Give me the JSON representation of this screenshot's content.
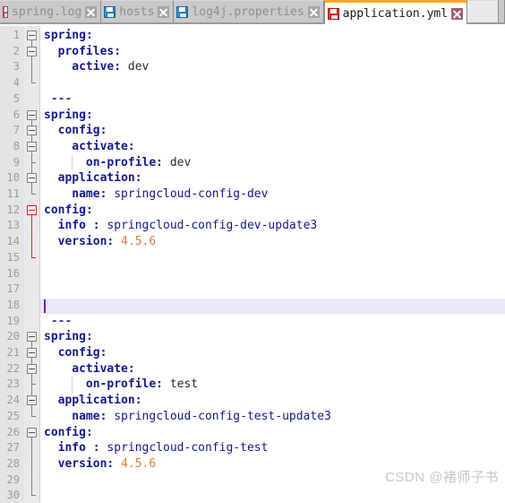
{
  "window": {
    "app_kind": "text-editor",
    "accent_active_tab": "#f5a623",
    "current_line_highlight": "#e8e8f8"
  },
  "tabbar": {
    "tabs": [
      {
        "label": "spring.log",
        "icon": "floppy-disk-icon",
        "icon_color": "#d06a87",
        "active": false,
        "close_label": "close-tab"
      },
      {
        "label": "hosts",
        "icon": "floppy-disk-icon",
        "icon_color": "#3d8fd8",
        "active": false,
        "close_label": "close-tab"
      },
      {
        "label": "log4j.properties",
        "icon": "floppy-disk-icon",
        "icon_color": "#3d8fd8",
        "active": false,
        "close_label": "close-tab"
      },
      {
        "label": "application.yml",
        "icon": "floppy-disk-icon",
        "icon_color": "#e03b2f",
        "active": true,
        "close_label": "close-tab"
      }
    ]
  },
  "editor": {
    "language": "yaml",
    "current_line": 18,
    "first_visible_line": 1,
    "last_visible_line": 30,
    "line_numbers": [
      "1",
      "2",
      "3",
      "4",
      "5",
      "6",
      "7",
      "8",
      "9",
      "10",
      "11",
      "12",
      "13",
      "14",
      "15",
      "16",
      "17",
      "18",
      "19",
      "20",
      "21",
      "22",
      "23",
      "24",
      "25",
      "26",
      "27",
      "28",
      "29",
      "30"
    ],
    "lines": [
      {
        "n": 1,
        "indent": 0,
        "key": "spring:",
        "value": "",
        "value_kind": "none"
      },
      {
        "n": 2,
        "indent": 2,
        "key": "profiles:",
        "value": "",
        "value_kind": "none"
      },
      {
        "n": 3,
        "indent": 4,
        "key": "active:",
        "value": "dev",
        "value_kind": "plain"
      },
      {
        "n": 4,
        "indent": 0,
        "key": "",
        "value": "",
        "value_kind": "none"
      },
      {
        "n": 5,
        "indent": 1,
        "key": "",
        "value": "---",
        "value_kind": "separator"
      },
      {
        "n": 6,
        "indent": 0,
        "key": "spring:",
        "value": "",
        "value_kind": "none"
      },
      {
        "n": 7,
        "indent": 2,
        "key": "config:",
        "value": "",
        "value_kind": "none"
      },
      {
        "n": 8,
        "indent": 4,
        "key": "activate:",
        "value": "",
        "value_kind": "none"
      },
      {
        "n": 9,
        "indent": 6,
        "key": "on-profile:",
        "value": "dev",
        "value_kind": "plain"
      },
      {
        "n": 10,
        "indent": 2,
        "key": "application:",
        "value": "",
        "value_kind": "none"
      },
      {
        "n": 11,
        "indent": 4,
        "key": "name:",
        "value": "springcloud-config-dev",
        "value_kind": "navy"
      },
      {
        "n": 12,
        "indent": 0,
        "key": "config:",
        "value": "",
        "value_kind": "none"
      },
      {
        "n": 13,
        "indent": 2,
        "key": "info :",
        "value": "springcloud-config-dev-update3",
        "value_kind": "navy"
      },
      {
        "n": 14,
        "indent": 2,
        "key": "version:",
        "value": "4.5.6",
        "value_kind": "number"
      },
      {
        "n": 15,
        "indent": 0,
        "key": "",
        "value": "",
        "value_kind": "none"
      },
      {
        "n": 16,
        "indent": 0,
        "key": "",
        "value": "",
        "value_kind": "none"
      },
      {
        "n": 17,
        "indent": 0,
        "key": "",
        "value": "",
        "value_kind": "none"
      },
      {
        "n": 18,
        "indent": 0,
        "key": "",
        "value": "",
        "value_kind": "none"
      },
      {
        "n": 19,
        "indent": 1,
        "key": "",
        "value": "---",
        "value_kind": "separator"
      },
      {
        "n": 20,
        "indent": 0,
        "key": "spring:",
        "value": "",
        "value_kind": "none"
      },
      {
        "n": 21,
        "indent": 2,
        "key": "config:",
        "value": "",
        "value_kind": "none"
      },
      {
        "n": 22,
        "indent": 4,
        "key": "activate:",
        "value": "",
        "value_kind": "none"
      },
      {
        "n": 23,
        "indent": 6,
        "key": "on-profile:",
        "value": "test",
        "value_kind": "plain"
      },
      {
        "n": 24,
        "indent": 2,
        "key": "application:",
        "value": "",
        "value_kind": "none"
      },
      {
        "n": 25,
        "indent": 4,
        "key": "name:",
        "value": "springcloud-config-test-update3",
        "value_kind": "navy"
      },
      {
        "n": 26,
        "indent": 0,
        "key": "config:",
        "value": "",
        "value_kind": "none"
      },
      {
        "n": 27,
        "indent": 2,
        "key": "info :",
        "value": "springcloud-config-test",
        "value_kind": "navy"
      },
      {
        "n": 28,
        "indent": 2,
        "key": "version:",
        "value": "4.5.6",
        "value_kind": "number"
      },
      {
        "n": 29,
        "indent": 0,
        "key": "",
        "value": "",
        "value_kind": "none"
      },
      {
        "n": 30,
        "indent": 0,
        "key": "",
        "value": "",
        "value_kind": "none"
      }
    ],
    "fold_markers": [
      {
        "line": 1,
        "state": "expanded",
        "color": "#808080",
        "span_to": 4
      },
      {
        "line": 2,
        "state": "expanded",
        "color": "#808080",
        "span_to": 4
      },
      {
        "line": 6,
        "state": "expanded",
        "color": "#808080",
        "span_to": 11
      },
      {
        "line": 7,
        "state": "expanded",
        "color": "#808080",
        "span_to": 11
      },
      {
        "line": 8,
        "state": "expanded",
        "color": "#808080",
        "span_to": 9
      },
      {
        "line": 10,
        "state": "expanded",
        "color": "#808080",
        "span_to": 11
      },
      {
        "line": 12,
        "state": "expanded",
        "color": "#d42a1a",
        "span_to": 15
      },
      {
        "line": 20,
        "state": "expanded",
        "color": "#808080",
        "span_to": 25
      },
      {
        "line": 21,
        "state": "expanded",
        "color": "#808080",
        "span_to": 25
      },
      {
        "line": 22,
        "state": "expanded",
        "color": "#808080",
        "span_to": 23
      },
      {
        "line": 24,
        "state": "expanded",
        "color": "#808080",
        "span_to": 25
      },
      {
        "line": 26,
        "state": "expanded",
        "color": "#808080",
        "span_to": 30
      }
    ]
  },
  "watermark": {
    "text": "CSDN @褚师子书"
  }
}
